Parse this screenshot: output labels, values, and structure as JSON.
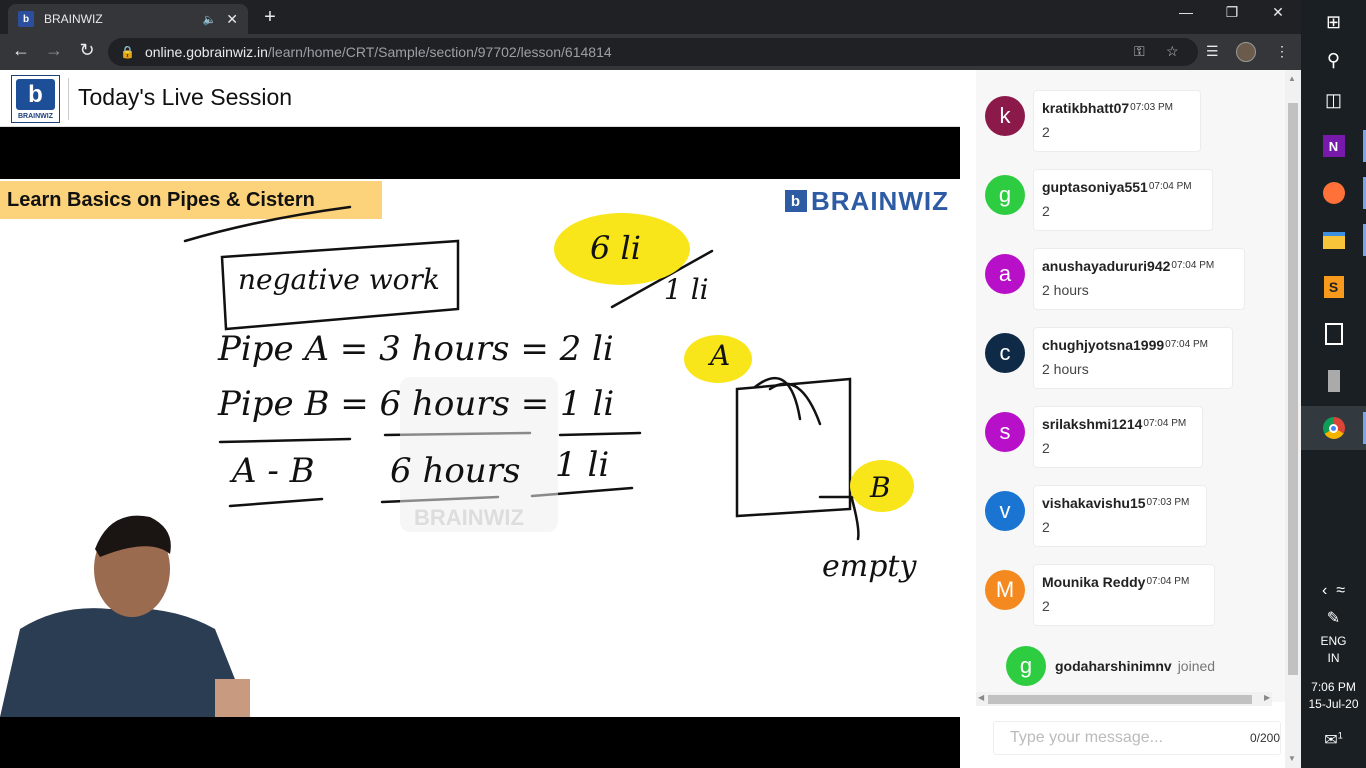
{
  "browser": {
    "tab_title": "BRAINWIZ",
    "favicon_letter": "b",
    "url_host": "online.gobrainwiz.in",
    "url_path": "/learn/home/CRT/Sample/section/97702/lesson/614814"
  },
  "page": {
    "logo_letter": "b",
    "logo_text": "BRAINWIZ",
    "title": "Today's Live Session"
  },
  "board": {
    "banner": "Learn Basics on Pipes & Cistern",
    "brand": "BRAINWIZ",
    "brand_letter": "b",
    "watermark": "BRAINWIZ",
    "notes": {
      "box": "negative work",
      "line1": "Pipe A = 3 hours = 2 li",
      "line2": "Pipe B = 6 hours = 1 li",
      "line3a": "A - B",
      "line3b": "6 hours",
      "line3c": "1 li",
      "cloud": "6 li",
      "cloud_under": "1 li",
      "tank_a": "A",
      "tank_b": "B",
      "empty": "empty"
    }
  },
  "chat": {
    "messages": [
      {
        "initial": "k",
        "color": "#8b1a4a",
        "user": "kratikbhatt07",
        "time": "07:03 PM",
        "text": "2"
      },
      {
        "initial": "g",
        "color": "#2ecc40",
        "user": "guptasoniya551",
        "time": "07:04 PM",
        "text": "2"
      },
      {
        "initial": "a",
        "color": "#b80fc8",
        "user": "anushayadururi942",
        "time": "07:04 PM",
        "text": "2 hours"
      },
      {
        "initial": "c",
        "color": "#0e2a47",
        "user": "chughjyotsna1999",
        "time": "07:04 PM",
        "text": "2 hours"
      },
      {
        "initial": "s",
        "color": "#b80fc8",
        "user": "srilakshmi1214",
        "time": "07:04 PM",
        "text": "2"
      },
      {
        "initial": "v",
        "color": "#1a74d2",
        "user": "vishakavishu15",
        "time": "07:03 PM",
        "text": "2"
      },
      {
        "initial": "M",
        "color": "#f48a1f",
        "user": "Mounika Reddy",
        "time": "07:04 PM",
        "text": "2"
      }
    ],
    "joined": {
      "initial": "g",
      "color": "#2ecc40",
      "user": "godaharshinimnv",
      "verb": "joined"
    },
    "input_placeholder": "Type your message...",
    "counter": "0/200"
  },
  "taskbar": {
    "lang1": "ENG",
    "lang2": "IN",
    "time": "7:06 PM",
    "date": "15-Jul-20",
    "notif_count": "1",
    "icons": [
      "windows-icon",
      "search-icon",
      "task-view-icon",
      "onenote-icon",
      "firefox-icon",
      "file-explorer-icon",
      "sublime-icon",
      "calculator-icon",
      "usb-drive-icon",
      "chrome-icon"
    ]
  }
}
